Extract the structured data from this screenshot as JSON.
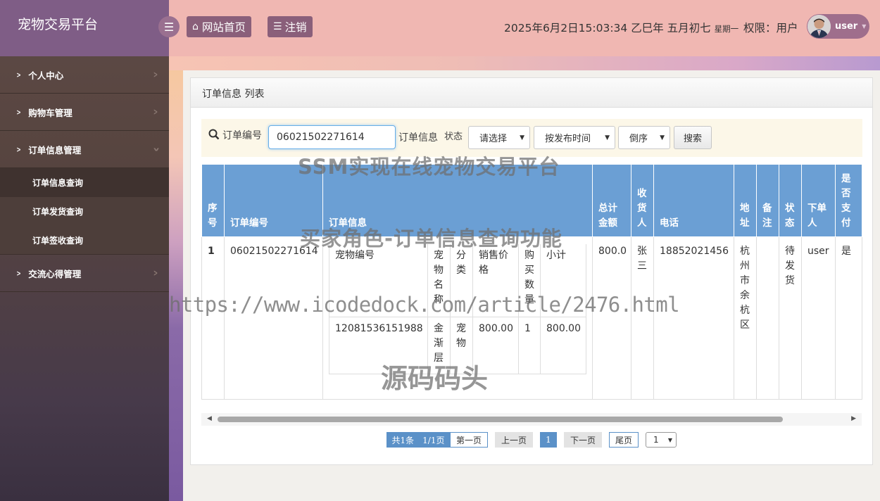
{
  "brand": {
    "title": "宠物交易平台"
  },
  "header": {
    "home_label": "网站首页",
    "logout_label": "注销",
    "datetime": "2025年6月2日15:03:34 乙巳年 五月初七",
    "weekday": "星期一",
    "role": "权限：用户",
    "username": "user"
  },
  "sidebar": {
    "items": [
      {
        "label": "个人中心"
      },
      {
        "label": "购物车管理"
      },
      {
        "label": "订单信息管理"
      },
      {
        "label": "交流心得管理"
      }
    ],
    "sub_items": [
      {
        "label": "订单信息查询"
      },
      {
        "label": "订单发货查询"
      },
      {
        "label": "订单签收查询"
      }
    ]
  },
  "panel": {
    "title": "订单信息 列表"
  },
  "search": {
    "label_order_no": "订单编号",
    "order_no_value": "06021502271614",
    "label_info": "订单信息",
    "label_status": "状态",
    "status_select": "请选择",
    "sort_select": "按发布时间",
    "order_select": "倒序",
    "button": "搜索"
  },
  "table": {
    "headers": [
      "序号",
      "订单编号",
      "订单信息",
      "总计金额",
      "收货人",
      "电话",
      "地址",
      "备注",
      "状态",
      "下单人",
      "是否支付"
    ],
    "rows": [
      {
        "index": "1",
        "order_no": "06021502271614",
        "total": "800.0",
        "receiver": "张三",
        "phone": "18852021456",
        "address": "杭州市余杭区",
        "remark": "",
        "status": "待发货",
        "buyer": "user",
        "paid": "是"
      }
    ],
    "inner_headers": [
      "宠物编号",
      "宠物名称",
      "分类",
      "销售价格",
      "购买数量",
      "小计"
    ],
    "inner_rows": [
      {
        "pet_no": "12081536151988",
        "pet_name": "金渐层",
        "category": "宠物",
        "price": "800.00",
        "qty": "1",
        "subtotal": "800.00"
      }
    ]
  },
  "pager": {
    "summary": "共1条　1/1页",
    "first": "第一页",
    "prev": "上一页",
    "current": "1",
    "next": "下一页",
    "last": "尾页",
    "page_select": "1"
  },
  "watermarks": {
    "title": "SSM实现在线宠物交易平台",
    "subtitle": "买家角色-订单信息查询功能",
    "url": "https://www.icodedock.com/article/2476.html",
    "site": "源码码头"
  }
}
